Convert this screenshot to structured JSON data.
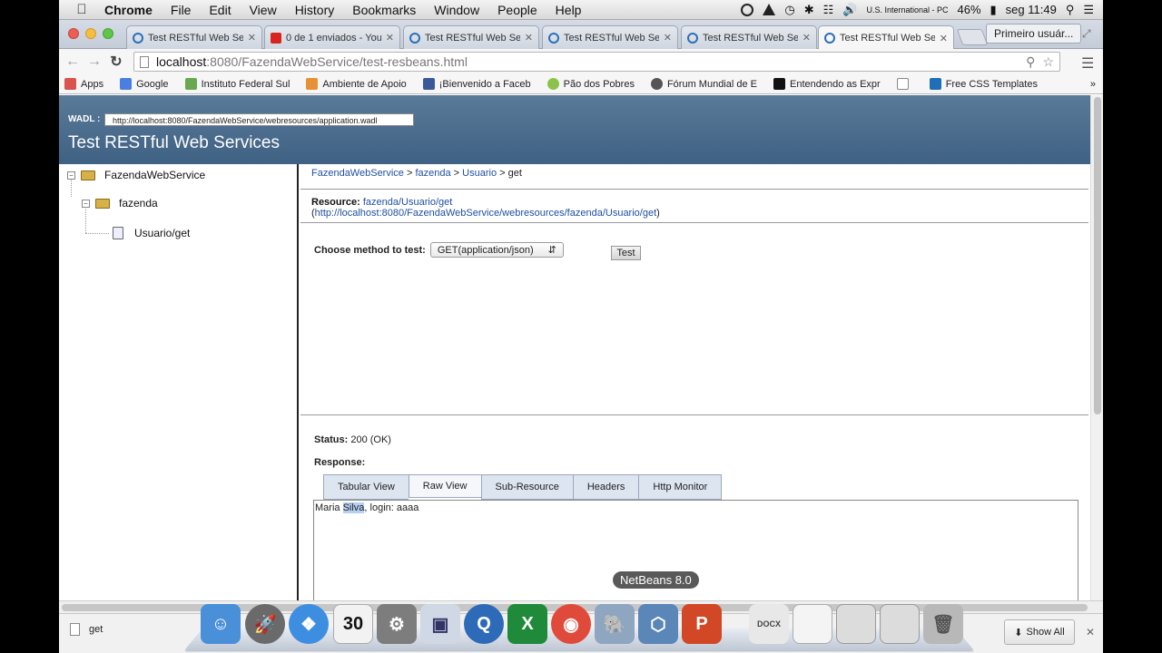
{
  "menubar": {
    "items": [
      "Chrome",
      "File",
      "Edit",
      "View",
      "History",
      "Bookmarks",
      "Window",
      "People",
      "Help"
    ],
    "keyboard": "U.S. International - PC",
    "battery": "46%",
    "clock": "seg 11:49"
  },
  "tabs": [
    {
      "label": "Test RESTful Web Serv",
      "icon": "netbeans-icon"
    },
    {
      "label": "0 de 1 enviados - You",
      "icon": "youtube-icon"
    },
    {
      "label": "Test RESTful Web Serv",
      "icon": "netbeans-icon"
    },
    {
      "label": "Test RESTful Web Serv",
      "icon": "netbeans-icon"
    },
    {
      "label": "Test RESTful Web Serv",
      "icon": "netbeans-icon"
    },
    {
      "label": "Test RESTful Web Serv",
      "icon": "netbeans-icon",
      "active": true
    }
  ],
  "profile_button": "Primeiro usuár...",
  "omnibox": {
    "host": "localhost",
    "path": ":8080/FazendaWebService/test-resbeans.html"
  },
  "bookmarks": [
    {
      "label": "Apps",
      "color": "#d9534f"
    },
    {
      "label": "Google",
      "color": "#4a7ee0"
    },
    {
      "label": "Instituto Federal Sul",
      "color": "#6aa84f"
    },
    {
      "label": "Ambiente de Apoio",
      "color": "#e69138"
    },
    {
      "label": "¡Bienvenido a Faceb",
      "color": "#3b5998"
    },
    {
      "label": "Pão dos Pobres",
      "color": "#8bc34a"
    },
    {
      "label": "Fórum Mundial de E",
      "color": "#555555"
    },
    {
      "label": "Entendendo as Expr",
      "color": "#111111"
    },
    {
      "label": "",
      "color": "#ffffff"
    },
    {
      "label": "Free CSS Templates",
      "color": "#1e6fb8"
    }
  ],
  "page": {
    "wadl_label": "WADL :",
    "wadl_url": "http://localhost:8080/FazendaWebService/webresources/application.wadl",
    "title": "Test RESTful Web Services",
    "tree": {
      "root": "FazendaWebService",
      "child": "fazenda",
      "leaf": "Usuario/get"
    },
    "breadcrumb": {
      "root": "FazendaWebService",
      "sep1": " > ",
      "child": "fazenda",
      "sep2": " > ",
      "leaf": "Usuario",
      "sep3": " > ",
      "last": "get"
    },
    "resource_label": "Resource:",
    "resource_path": "fazenda/Usuario/get",
    "resource_full": "http://localhost:8080/FazendaWebService/webresources/fazenda/Usuario/get",
    "method_label": "Choose method to test:",
    "method_value": "GET(application/json)",
    "test_button": "Test",
    "status_label": "Status:",
    "status_value": "200 (OK)",
    "response_label": "Response:",
    "response_tabs": [
      "Tabular View",
      "Raw View",
      "Sub-Resource",
      "Headers",
      "Http Monitor"
    ],
    "response": {
      "pre": "Maria ",
      "hl": "Silva",
      "post": ", login: aaaa"
    }
  },
  "downloads": {
    "file": "get",
    "show_all": "Show All"
  },
  "dock_tooltip": "NetBeans 8.0",
  "dock_icons": [
    {
      "name": "finder-icon",
      "color": "#4a90d9"
    },
    {
      "name": "launchpad-icon",
      "color": "#6a6a6a"
    },
    {
      "name": "safari-icon",
      "color": "#3d8ee0"
    },
    {
      "name": "calendar-icon",
      "color": "#f2f2f2"
    },
    {
      "name": "system-preferences-icon",
      "color": "#7d7d7d"
    },
    {
      "name": "preview-icon",
      "color": "#cfd8e4"
    },
    {
      "name": "quicktime-icon",
      "color": "#2d6ab8"
    },
    {
      "name": "excel-icon",
      "color": "#1f8b3a"
    },
    {
      "name": "chrome-icon",
      "color": "#e04a3a"
    },
    {
      "name": "postgresql-icon",
      "color": "#8ea6c0"
    },
    {
      "name": "netbeans-icon",
      "color": "#5a86b8"
    },
    {
      "name": "powerpoint-icon",
      "color": "#d24726"
    },
    {
      "name": "docx-file-icon",
      "color": "#e8e8e8"
    },
    {
      "name": "blank-file-icon",
      "color": "#f4f4f4"
    },
    {
      "name": "window-thumbnail-icon",
      "color": "#dcdcdc"
    },
    {
      "name": "window-thumbnail-2-icon",
      "color": "#dcdcdc"
    },
    {
      "name": "trash-icon",
      "color": "#b8b8b8"
    }
  ],
  "calendar_day": "30"
}
